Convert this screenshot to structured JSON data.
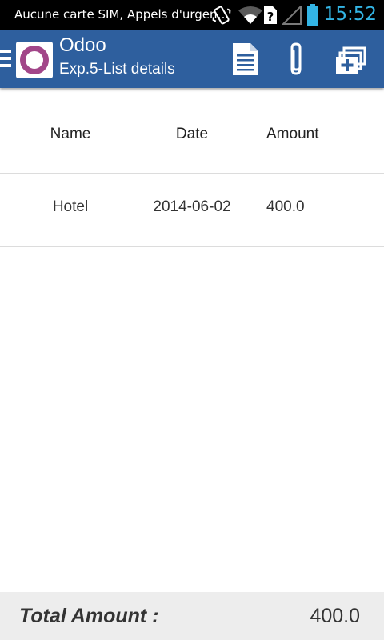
{
  "status_bar": {
    "carrier_text": "Aucune carte SIM, Appels d'urgen…",
    "time": "15:52",
    "icons": [
      "vibrate-icon",
      "wifi-icon",
      "no-sim-icon",
      "signal-icon",
      "battery-icon"
    ],
    "time_color": "#33b5e5"
  },
  "action_bar": {
    "title": "Odoo",
    "subtitle": "Exp.5-List details",
    "background": "#2e5f9e",
    "logo_color": "#a24689",
    "actions": [
      "document-icon",
      "attachment-icon",
      "add-window-icon"
    ]
  },
  "table": {
    "columns": [
      "Name",
      "Date",
      "Amount"
    ],
    "rows": [
      {
        "name": "Hotel",
        "date": "2014-06-02",
        "amount": "400.0"
      }
    ]
  },
  "footer": {
    "total_label": "Total Amount :",
    "total_value": "400.0"
  }
}
